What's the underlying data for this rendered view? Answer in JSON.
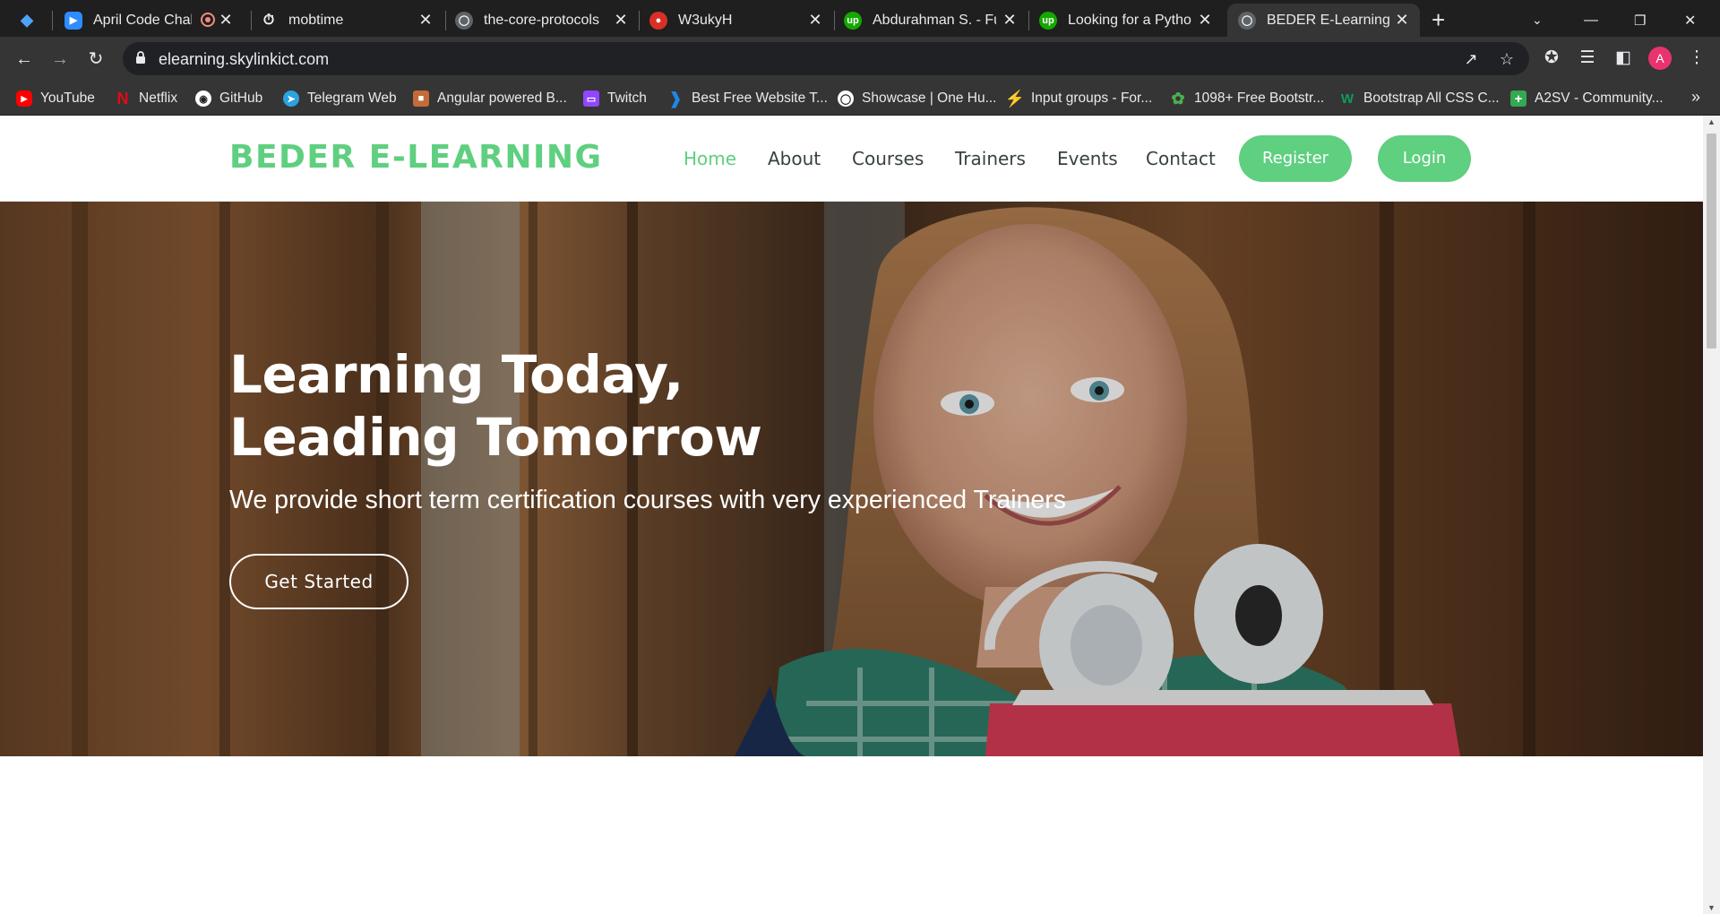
{
  "browser": {
    "tabs": [
      {
        "title": "April Code Challe",
        "favicon": "zoom-icon",
        "color": "#2d8cff",
        "active": false
      },
      {
        "title": "mobtime",
        "favicon": "timer-icon",
        "color": "#ffffff",
        "active": false
      },
      {
        "title": "the-core-protocols",
        "favicon": "globe-icon",
        "color": "#9aa0a6",
        "active": false
      },
      {
        "title": "W3ukyH",
        "favicon": "w3-icon",
        "color": "#d93025",
        "active": false
      },
      {
        "title": "Abdurahman S. - Full",
        "favicon": "upwork-icon",
        "color": "#14a800",
        "active": false
      },
      {
        "title": "Looking for a Python",
        "favicon": "upwork-icon",
        "color": "#14a800",
        "active": false
      },
      {
        "title": "BEDER E-Learning - p",
        "favicon": "globe-icon",
        "color": "#9aa0a6",
        "active": true
      }
    ],
    "url": "elearning.skylinkict.com",
    "profile_initial": "A",
    "bookmarks": [
      {
        "label": "YouTube",
        "icon": "youtube-icon",
        "color": "#ff0000"
      },
      {
        "label": "Netflix",
        "icon": "netflix-icon",
        "color": "#e50914"
      },
      {
        "label": "GitHub",
        "icon": "github-icon",
        "color": "#ffffff"
      },
      {
        "label": "Telegram Web",
        "icon": "telegram-icon",
        "color": "#2aa3df"
      },
      {
        "label": "Angular powered B...",
        "icon": "angular-icon",
        "color": "#c36b3a"
      },
      {
        "label": "Twitch",
        "icon": "twitch-icon",
        "color": "#9146ff"
      },
      {
        "label": "Best Free Website T...",
        "icon": "website-icon",
        "color": "#1e88e5"
      },
      {
        "label": "Showcase | One Hu...",
        "icon": "globe-icon",
        "color": "#ffffff"
      },
      {
        "label": "Input groups - For...",
        "icon": "bootstrap-icon",
        "color": "#7952b3"
      },
      {
        "label": "1098+ Free Bootstr...",
        "icon": "leaf-icon",
        "color": "#4caf50"
      },
      {
        "label": "Bootstrap All CSS C...",
        "icon": "w-icon",
        "color": "#0f9d58"
      },
      {
        "label": "A2SV - Community...",
        "icon": "plus-icon",
        "color": "#34a853"
      }
    ]
  },
  "site": {
    "logo": "BEDER E-LEARNING",
    "nav": [
      {
        "label": "Home",
        "active": true
      },
      {
        "label": "About",
        "active": false
      },
      {
        "label": "Courses",
        "active": false
      },
      {
        "label": "Trainers",
        "active": false
      },
      {
        "label": "Events",
        "active": false
      },
      {
        "label": "Contact",
        "active": false
      }
    ],
    "register_label": "Register",
    "login_label": "Login",
    "accent_color": "#5fcf80"
  },
  "hero": {
    "title_line1": "Learning Today,",
    "title_line2": "Leading Tomorrow",
    "subtitle": "We provide short term certification courses with very experienced Trainers",
    "cta_label": "Get Started"
  }
}
